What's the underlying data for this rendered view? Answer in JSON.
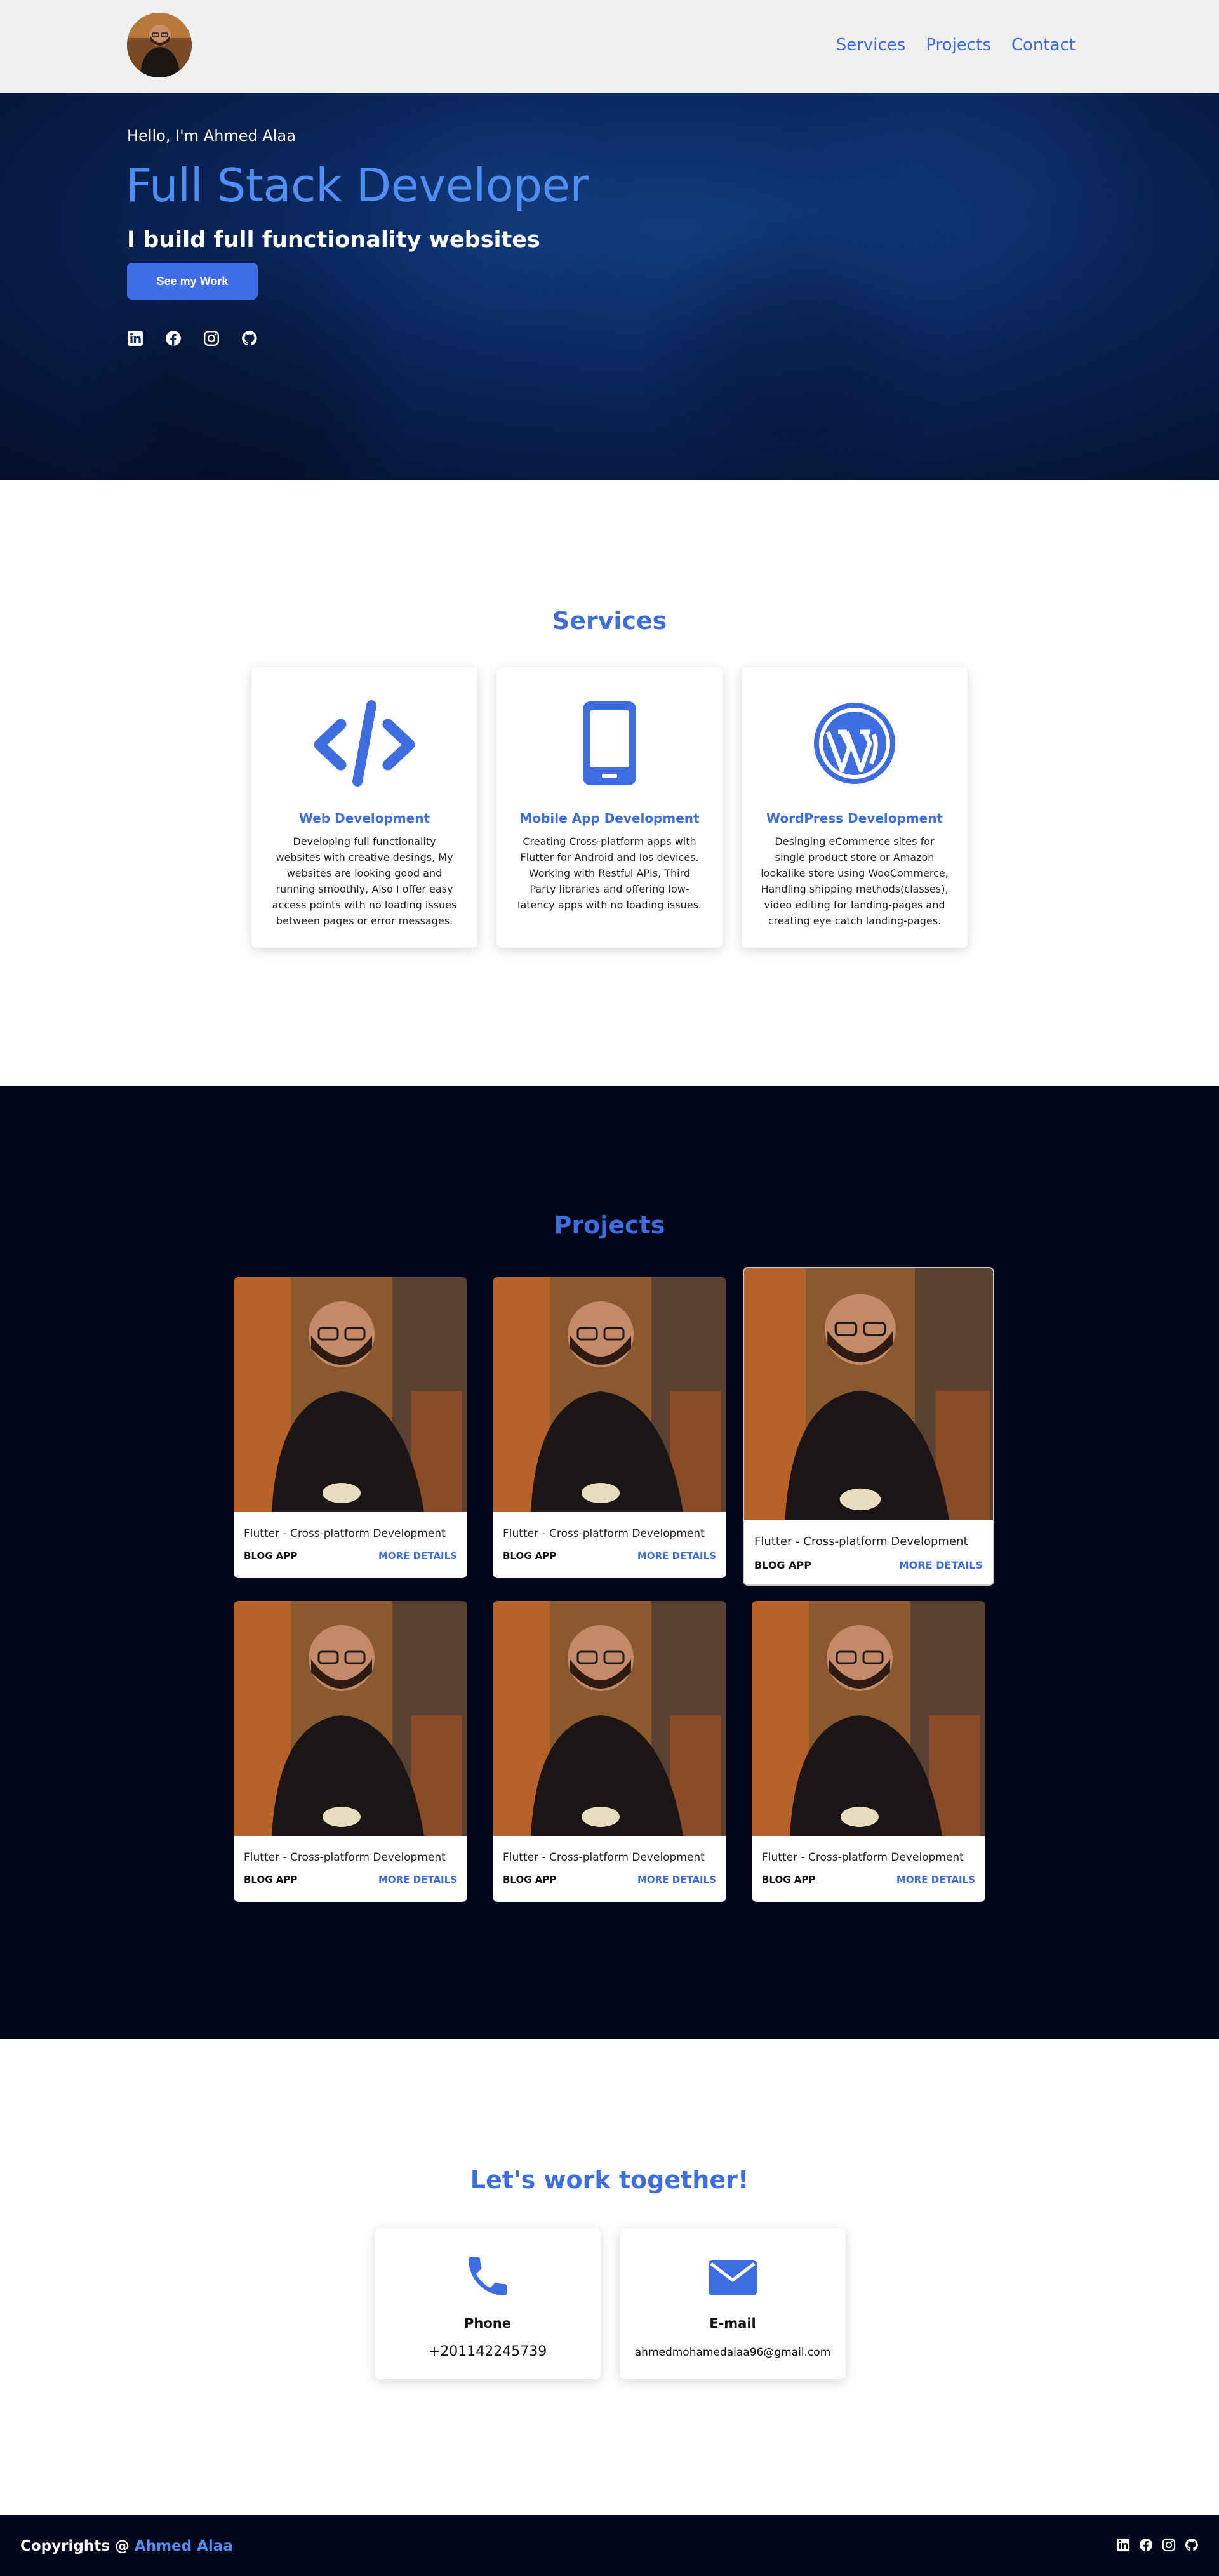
{
  "nav": {
    "links": [
      "Services",
      "Projects",
      "Contact"
    ]
  },
  "hero": {
    "greeting": "Hello, I'm Ahmed Alaa",
    "title": "Full Stack Developer",
    "subtitle": "I build full functionality websites",
    "cta": "See my Work",
    "social_icons": [
      "linkedin-icon",
      "facebook-icon",
      "instagram-icon",
      "github-icon"
    ]
  },
  "services": {
    "title": "Services",
    "items": [
      {
        "icon": "code-icon",
        "name": "Web Development",
        "desc": "Developing full functionality websites with creative desings, My websites are looking good and running smoothly, Also I offer easy access points with no loading issues between pages or error messages."
      },
      {
        "icon": "mobile-phone-icon",
        "name": "Mobile App Development",
        "desc": "Creating Cross-platform apps with Flutter for Android and Ios devices. Working with Restful APIs, Third Party libraries and offering low-latency apps with no loading issues."
      },
      {
        "icon": "wordpress-icon",
        "name": "WordPress Development",
        "desc": "Desinging eCommerce sites for single product store or Amazon lookalike store using WooCommerce, Handling shipping methods(classes), video editing for landing-pages and creating eye catch landing-pages."
      }
    ]
  },
  "projects": {
    "title": "Projects",
    "items": [
      {
        "tech": "Flutter - Cross-platform Development",
        "name": "BLOG APP",
        "more": "MORE DETAILS"
      },
      {
        "tech": "Flutter - Cross-platform Development",
        "name": "BLOG APP",
        "more": "MORE DETAILS"
      },
      {
        "tech": "Flutter - Cross-platform Development",
        "name": "BLOG APP",
        "more": "MORE DETAILS"
      },
      {
        "tech": "Flutter - Cross-platform Development",
        "name": "BLOG APP",
        "more": "MORE DETAILS"
      },
      {
        "tech": "Flutter - Cross-platform Development",
        "name": "BLOG APP",
        "more": "MORE DETAILS"
      },
      {
        "tech": "Flutter - Cross-platform Development",
        "name": "BLOG APP",
        "more": "MORE DETAILS"
      }
    ]
  },
  "contact": {
    "title": "Let's work together!",
    "phone_label": "Phone",
    "phone_value": "+201142245739",
    "email_label": "E-mail",
    "email_value": "ahmedmohamedalaa96@gmail.com"
  },
  "footer": {
    "prefix": "Copyrights @ ",
    "name": "Ahmed Alaa"
  },
  "colors": {
    "accent": "#3e6de0",
    "hero_title": "#4f8ff3",
    "dark_bg": "#03071b"
  }
}
